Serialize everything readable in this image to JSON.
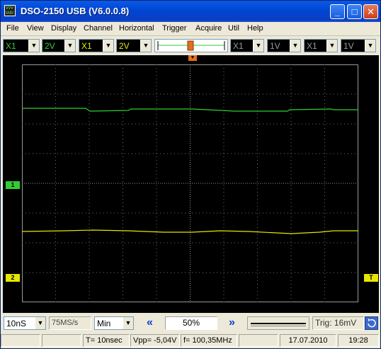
{
  "window": {
    "title": "DSO-2150 USB (V6.0.0.8)",
    "icon": "scope-app-icon",
    "icon_text": "VVV\nUUU"
  },
  "titlebar_buttons": {
    "minimize": "_",
    "maximize": "□",
    "close": "✕"
  },
  "menu": [
    "File",
    "View",
    "Display",
    "Channel",
    "Horizontal",
    "Trigger",
    "Acquire",
    "Util",
    "Help"
  ],
  "toolbar": {
    "ch1_probe": "X1",
    "ch1_volts": "2V",
    "ch2_probe": "X1",
    "ch2_volts": "2V",
    "ch3_probe": "X1",
    "ch3_volts": "1V",
    "ch4_probe": "X1",
    "ch4_volts": "1V"
  },
  "scope": {
    "ch1_marker": "1",
    "ch2_marker": "2",
    "trig_marker": "T",
    "colors": {
      "ch1": "#33cc33",
      "ch2": "#e6e600",
      "grid": "#7a7a7a",
      "background": "#000000"
    }
  },
  "bottom": {
    "timebase": "10nS",
    "sample_rate": "75MS/s",
    "mode": "Min",
    "position": "50%",
    "trig_level": "Trig: 16mV",
    "left_arrow": "«",
    "right_arrow": "»"
  },
  "status": {
    "timing": "T= 10nsec",
    "vpp": "Vpp= -5,04V",
    "freq": "f= 100,35MHz",
    "date": "17.07.2010",
    "time": "19:28"
  }
}
